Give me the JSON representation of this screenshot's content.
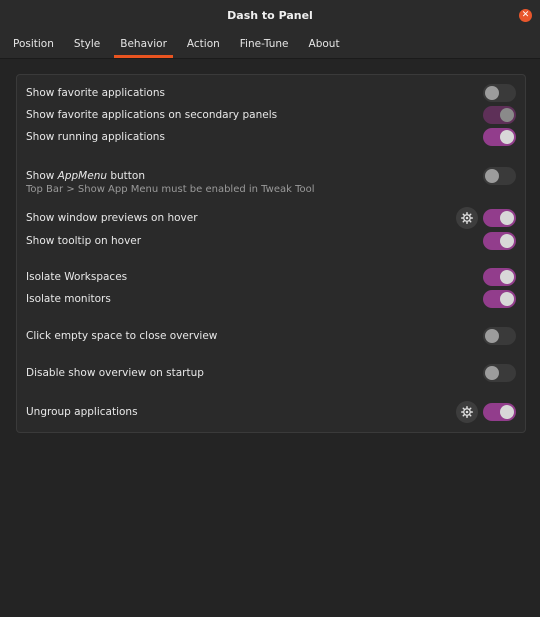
{
  "window": {
    "title": "Dash to Panel"
  },
  "tabs": [
    {
      "label": "Position"
    },
    {
      "label": "Style"
    },
    {
      "label": "Behavior"
    },
    {
      "label": "Action"
    },
    {
      "label": "Fine-Tune"
    },
    {
      "label": "About"
    }
  ],
  "active_tab": "Behavior",
  "settings": {
    "show_favorite_apps": {
      "label": "Show favorite applications",
      "state": "off"
    },
    "show_favorite_secondary": {
      "label": "Show favorite applications on secondary panels",
      "state": "on (insensitive)"
    },
    "show_running_apps": {
      "label": "Show running applications",
      "state": "on"
    },
    "show_appmenu": {
      "label_prefix": "Show ",
      "label_italic": "AppMenu",
      "label_suffix": " button",
      "note": "Top Bar > Show App Menu must be enabled in Tweak Tool",
      "state": "off"
    },
    "window_previews": {
      "label": "Show window previews on hover",
      "state": "on"
    },
    "tooltip_hover": {
      "label": "Show tooltip on hover",
      "state": "on"
    },
    "isolate_workspaces": {
      "label": "Isolate Workspaces",
      "state": "on"
    },
    "isolate_monitors": {
      "label": "Isolate monitors",
      "state": "on"
    },
    "click_empty_close": {
      "label": "Click empty space to close overview",
      "state": "off"
    },
    "disable_overview": {
      "label": "Disable show overview on startup",
      "state": "off"
    },
    "ungroup_apps": {
      "label": "Ungroup applications",
      "state": "on"
    }
  },
  "colors": {
    "accent": "#e95420",
    "toggle_on": "#923d8c",
    "close": "#e9572c"
  },
  "icons": {
    "close": "close-icon",
    "settings": "gear-icon"
  }
}
